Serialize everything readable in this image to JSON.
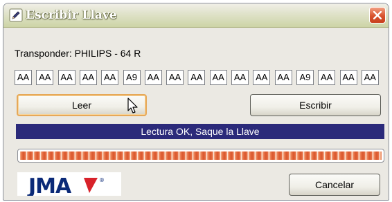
{
  "window": {
    "title": "Escribir Llave",
    "title_icon": "pencil-icon",
    "close_icon": "close-icon"
  },
  "transponder": {
    "label": "Transponder: PHILIPS - 64 R"
  },
  "bytes": [
    "AA",
    "AA",
    "AA",
    "AA",
    "AA",
    "A9",
    "AA",
    "AA",
    "AA",
    "AA",
    "AA",
    "AA",
    "AA",
    "A9",
    "AA",
    "AA",
    "AA"
  ],
  "buttons": {
    "read": "Leer",
    "write": "Escribir",
    "cancel": "Cancelar"
  },
  "status": {
    "message": "Lectura OK, Saque la Llave"
  },
  "progress": {
    "fraction": 1.0
  },
  "logo": {
    "text": "JMA",
    "mark": "®"
  },
  "colors": {
    "status_bg": "#2b2a7a",
    "progress": "#e0623a",
    "close": "#d8522d",
    "logo_blue": "#0b2a78"
  }
}
